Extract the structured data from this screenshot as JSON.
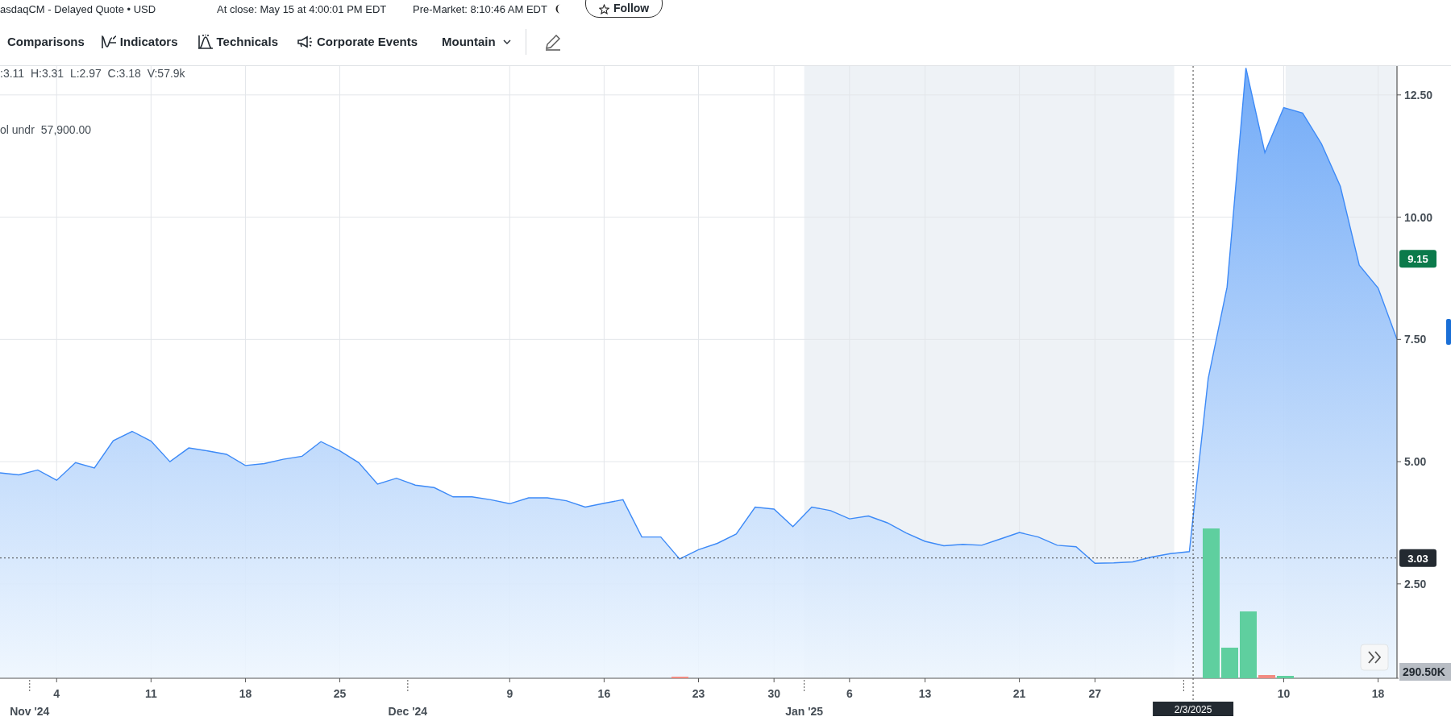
{
  "quote_bar": {
    "exchange_text": "asdaqCM - Delayed Quote • USD",
    "close_time": "At close: May 15 at 4:00:01 PM EDT",
    "premarket_time": "Pre-Market: 8:10:46 AM EDT",
    "follow_button": "Follow"
  },
  "toolbar": {
    "items": [
      {
        "label": "Comparisons",
        "kind": "comparisons"
      },
      {
        "label": "Indicators",
        "kind": "indicators"
      },
      {
        "label": "Technicals",
        "kind": "technicals"
      },
      {
        "label": "Corporate Events",
        "kind": "events"
      }
    ],
    "chart_type": "Mountain"
  },
  "legend": {
    "ohlcv": ":3.11  H:3.31  L:2.97  C:3.18  V:57.9k",
    "volume_label": "ol undr",
    "volume_value": "57,900.00"
  },
  "chart": {
    "chart_data": {
      "type": "area",
      "grid": true,
      "yticks": [
        {
          "value": 2.5,
          "label": "2.50"
        },
        {
          "value": 5,
          "label": "5.00"
        },
        {
          "value": 7.5,
          "label": "7.50"
        },
        {
          "value": 10,
          "label": "10.00"
        },
        {
          "value": 12.5,
          "label": "12.50"
        }
      ],
      "ylim": [
        0.57,
        13.09
      ],
      "categories": [
        null,
        null,
        null,
        "4",
        null,
        null,
        null,
        null,
        "11",
        null,
        null,
        null,
        null,
        "18",
        null,
        null,
        null,
        null,
        "25",
        null,
        null,
        null,
        null,
        null,
        null,
        null,
        null,
        "9",
        null,
        null,
        null,
        null,
        "16",
        null,
        null,
        null,
        null,
        "23",
        null,
        null,
        null,
        "30",
        null,
        null,
        null,
        "6",
        null,
        null,
        null,
        "13",
        null,
        null,
        null,
        null,
        "21",
        null,
        null,
        null,
        "27",
        null,
        null,
        null,
        null,
        null,
        null,
        null,
        null,
        null,
        "10",
        null,
        null,
        null,
        null,
        "18",
        null
      ],
      "series": [
        {
          "color": "#3d8af7",
          "values": [
            4.77,
            4.73,
            4.83,
            4.62,
            4.98,
            4.87,
            5.43,
            5.62,
            5.42,
            5.0,
            5.28,
            5.22,
            5.15,
            4.92,
            4.96,
            5.05,
            5.11,
            5.41,
            5.22,
            4.98,
            4.54,
            4.66,
            4.52,
            4.47,
            4.28,
            4.28,
            4.22,
            4.14,
            4.26,
            4.26,
            4.2,
            4.07,
            4.15,
            4.22,
            3.46,
            3.46,
            3.01,
            3.2,
            3.33,
            3.52,
            4.07,
            4.03,
            3.67,
            4.07,
            4.0,
            3.83,
            3.89,
            3.75,
            3.54,
            3.37,
            3.28,
            3.31,
            3.29,
            3.42,
            3.55,
            3.46,
            3.29,
            3.26,
            2.92,
            2.93,
            2.95,
            3.05,
            3.12,
            3.16,
            6.7,
            8.57,
            13.05,
            11.32,
            12.24,
            12.13,
            11.5,
            10.63,
            9.02,
            8.55,
            7.5
          ]
        }
      ],
      "ref_lines": [
        {
          "value": 3.03,
          "axis": "y",
          "label": "3.03"
        }
      ],
      "annotations": [
        "9.15"
      ]
    },
    "crosshair_date": "2/3/2025",
    "month_labels": [
      "Nov '24",
      "Dec '24",
      "Jan '25"
    ],
    "volume_tag": "290.50K"
  }
}
